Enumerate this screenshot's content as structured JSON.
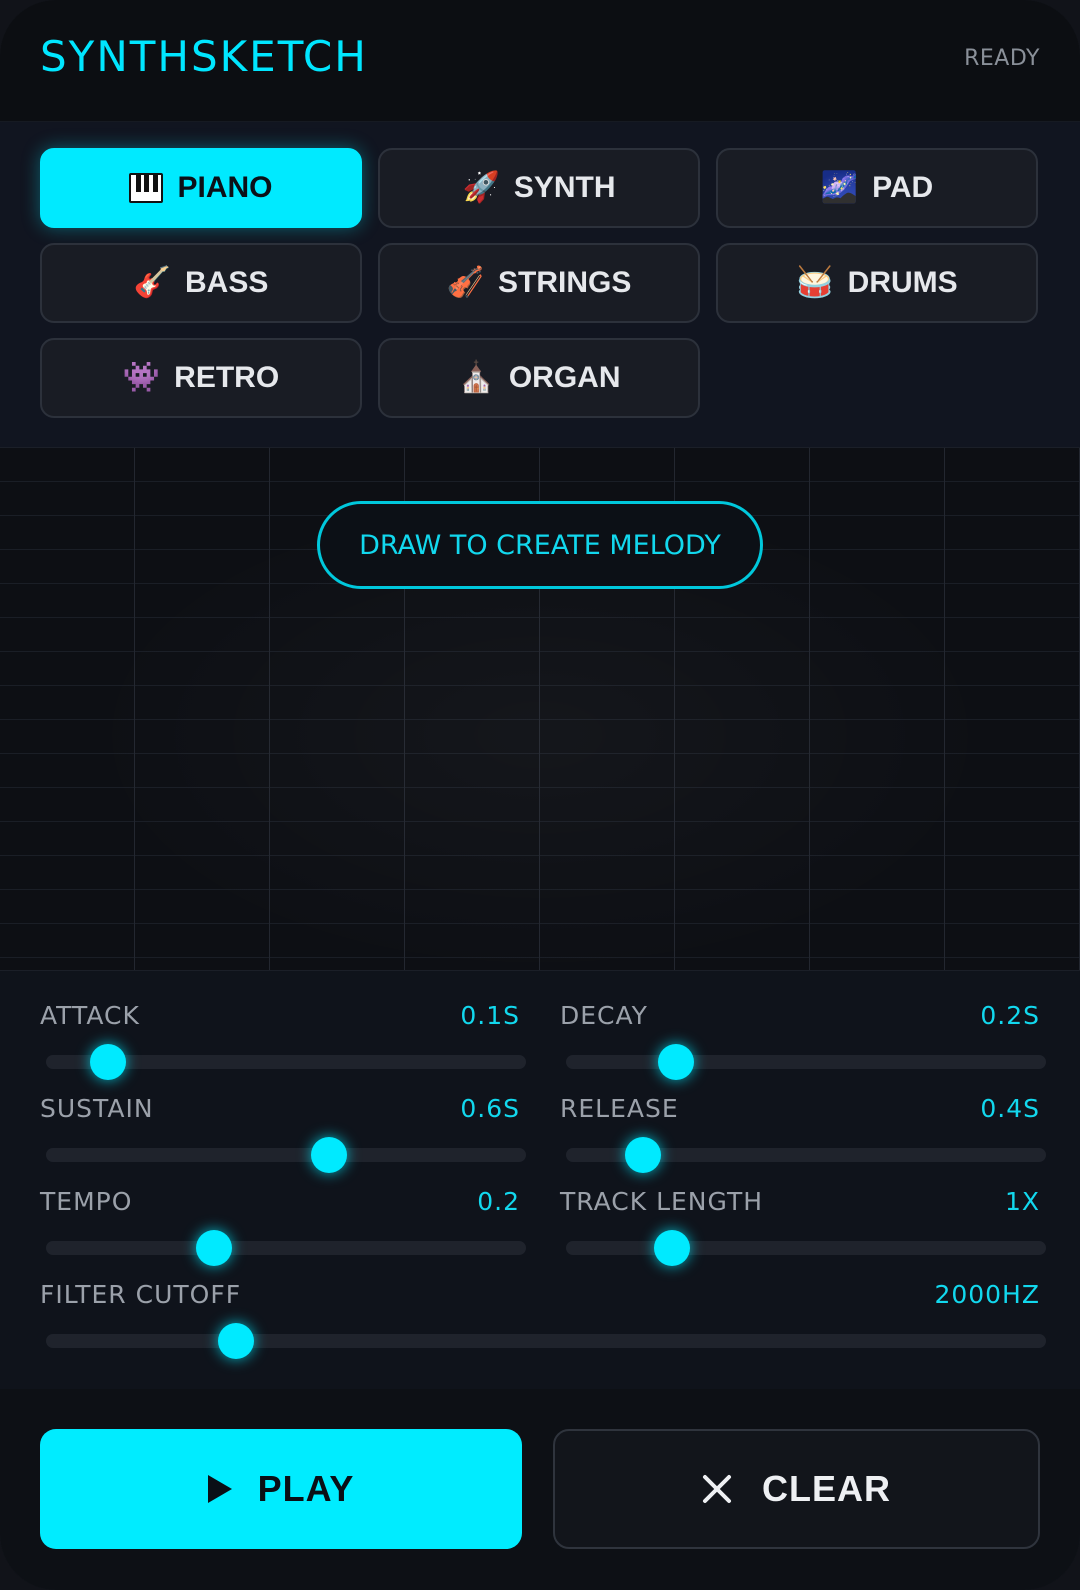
{
  "header": {
    "title": "SYNTHSKETCH",
    "status": "READY"
  },
  "instruments": [
    {
      "label": "PIANO",
      "icon": "piano-keys-icon",
      "emoji": "",
      "active": true
    },
    {
      "label": "SYNTH",
      "icon": "rocket-icon",
      "emoji": "🚀",
      "active": false
    },
    {
      "label": "PAD",
      "icon": "galaxy-icon",
      "emoji": "🌌",
      "active": false
    },
    {
      "label": "BASS",
      "icon": "guitar-icon",
      "emoji": "🎸",
      "active": false
    },
    {
      "label": "STRINGS",
      "icon": "violin-icon",
      "emoji": "🎻",
      "active": false
    },
    {
      "label": "DRUMS",
      "icon": "drum-icon",
      "emoji": "🥁",
      "active": false
    },
    {
      "label": "RETRO",
      "icon": "space-invader-icon",
      "emoji": "👾",
      "active": false
    },
    {
      "label": "ORGAN",
      "icon": "church-icon",
      "emoji": "⛪",
      "active": false
    }
  ],
  "canvas": {
    "prompt": "DRAW TO CREATE MELODY"
  },
  "controls": {
    "attack": {
      "label": "ATTACK",
      "value": "0.1S",
      "level": 0.13
    },
    "decay": {
      "label": "DECAY",
      "value": "0.2S",
      "level": 0.23
    },
    "sustain": {
      "label": "SUSTAIN",
      "value": "0.6S",
      "level": 0.59
    },
    "release": {
      "label": "RELEASE",
      "value": "0.4S",
      "level": 0.16
    },
    "tempo": {
      "label": "TEMPO",
      "value": "0.2",
      "level": 0.35
    },
    "track_length": {
      "label": "TRACK LENGTH",
      "value": "1X",
      "level": 0.22
    },
    "filter_cutoff": {
      "label": "FILTER CUTOFF",
      "value": "2000HZ",
      "level": 0.19
    }
  },
  "footer": {
    "play_label": "PLAY",
    "clear_label": "CLEAR"
  },
  "colors": {
    "accent": "#00eaff",
    "background": "#0d1016"
  }
}
